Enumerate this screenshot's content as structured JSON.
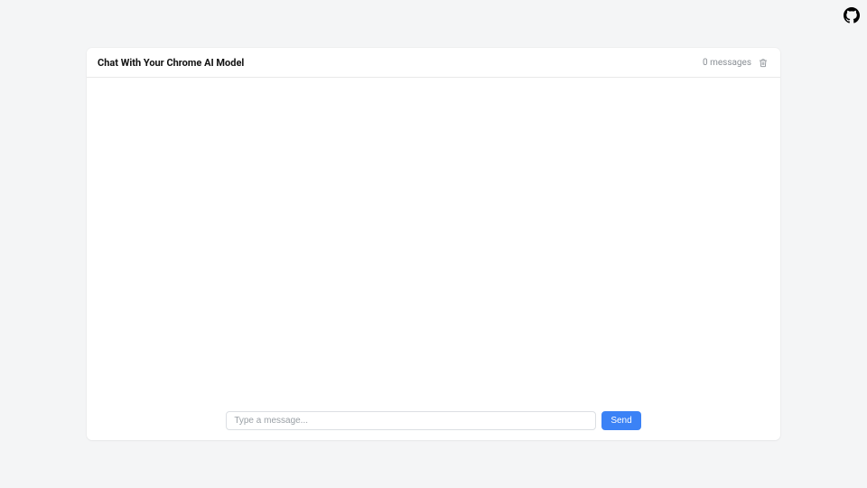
{
  "header": {
    "title": "Chat With Your Chrome AI Model",
    "message_count": "0 messages"
  },
  "composer": {
    "placeholder": "Type a message...",
    "value": "",
    "send_label": "Send"
  },
  "icons": {
    "github": "github-icon",
    "trash": "trash-icon"
  }
}
